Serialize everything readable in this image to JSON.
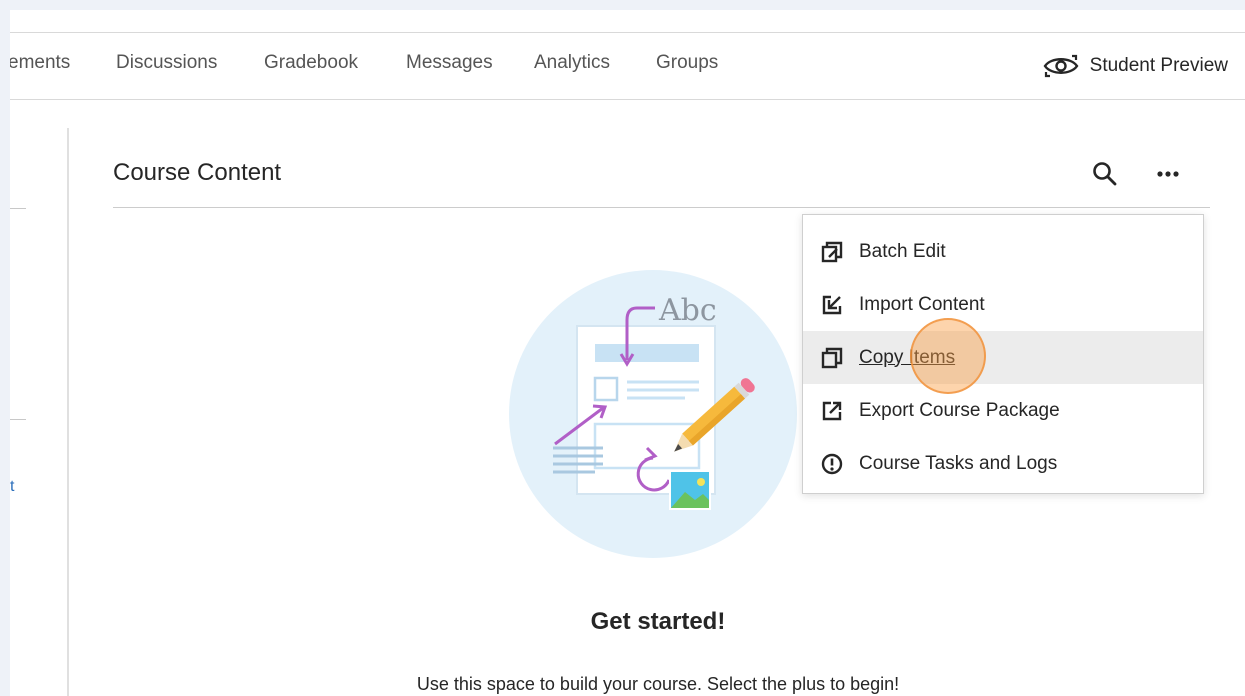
{
  "nav": {
    "tabs": [
      {
        "label": "ements"
      },
      {
        "label": "Discussions"
      },
      {
        "label": "Gradebook"
      },
      {
        "label": "Messages"
      },
      {
        "label": "Analytics"
      },
      {
        "label": "Groups"
      }
    ],
    "student_preview": {
      "label": "Student Preview",
      "icon": "eye-icon"
    }
  },
  "sidebar": {
    "partial_text": "t"
  },
  "course_content": {
    "title": "Course Content",
    "search_icon": "search-icon",
    "more_icon": "more-options-icon"
  },
  "menu": {
    "items": [
      {
        "label": "Batch Edit",
        "icon": "batch-edit-icon"
      },
      {
        "label": "Import Content",
        "icon": "import-icon"
      },
      {
        "label": "Copy Items",
        "icon": "copy-icon"
      },
      {
        "label": "Export Course Package",
        "icon": "export-icon"
      },
      {
        "label": "Course Tasks and Logs",
        "icon": "alert-circle-icon"
      }
    ],
    "highlighted_index": 2
  },
  "empty_state": {
    "illustration_text": "Abc",
    "heading": "Get started!",
    "description": "Use this space to build your course. Select the plus to begin!"
  },
  "colors": {
    "accent_orange": "#f5a04a",
    "illustration_bg": "#e3f1fa",
    "link_blue": "#2a6ebb"
  }
}
